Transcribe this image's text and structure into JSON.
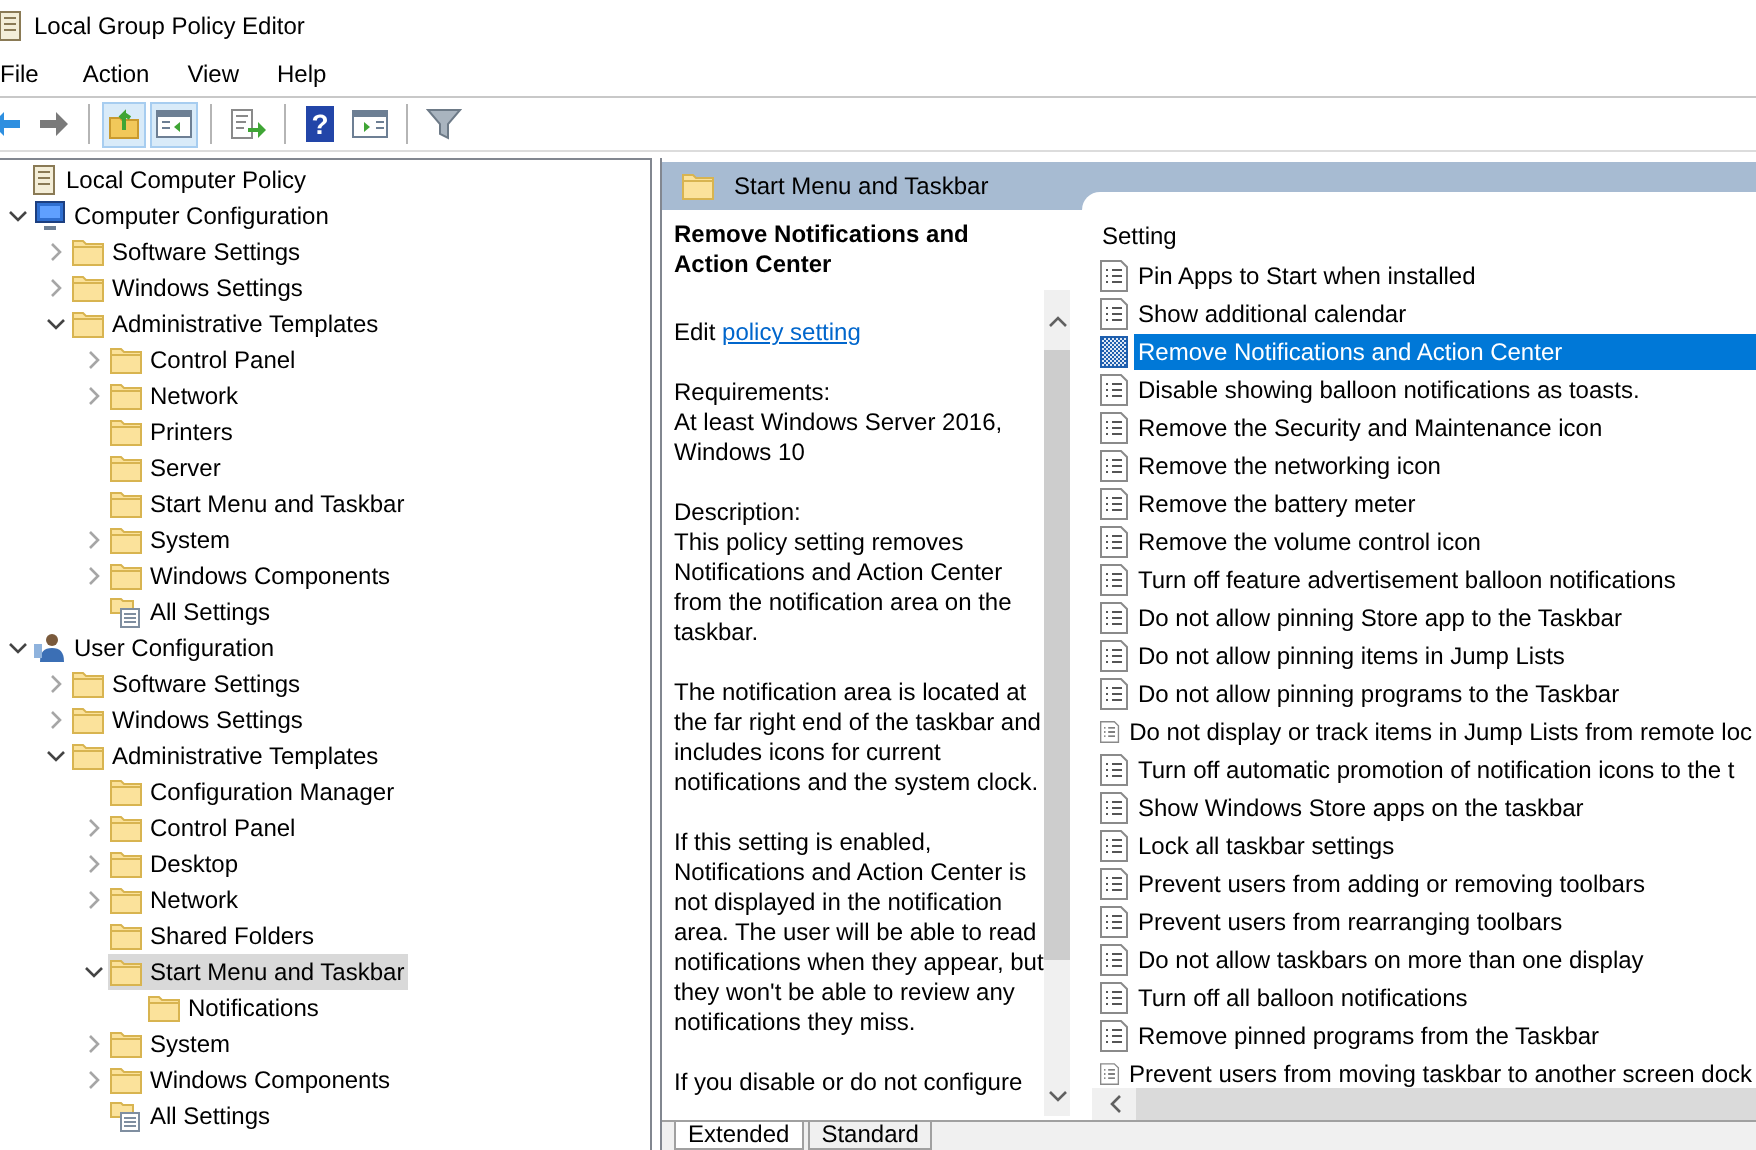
{
  "window": {
    "title": "Local Group Policy Editor"
  },
  "menu": [
    "File",
    "Action",
    "View",
    "Help"
  ],
  "toolbar": [
    {
      "kind": "back",
      "pressed": false
    },
    {
      "kind": "forward",
      "pressed": false
    },
    {
      "kind": "separator"
    },
    {
      "kind": "up",
      "pressed": true
    },
    {
      "kind": "tree",
      "pressed": true
    },
    {
      "kind": "separator"
    },
    {
      "kind": "export",
      "pressed": false
    },
    {
      "kind": "separator"
    },
    {
      "kind": "help",
      "label": "?",
      "pressed": false
    },
    {
      "kind": "action",
      "pressed": false
    },
    {
      "kind": "separator"
    },
    {
      "kind": "filter",
      "pressed": false
    }
  ],
  "tree": [
    {
      "label": "Local Computer Policy",
      "kind": "policy",
      "selected": false,
      "children": [
        {
          "label": "Computer Configuration",
          "kind": "computer",
          "expanded": true,
          "selected": false,
          "children": [
            {
              "label": "Software Settings",
              "kind": "folder",
              "expanded": false,
              "selected": false
            },
            {
              "label": "Windows Settings",
              "kind": "folder",
              "expanded": false,
              "selected": false
            },
            {
              "label": "Administrative Templates",
              "kind": "folder",
              "expanded": true,
              "selected": false,
              "children": [
                {
                  "label": "Control Panel",
                  "kind": "folder",
                  "expanded": false,
                  "selected": false
                },
                {
                  "label": "Network",
                  "kind": "folder",
                  "expanded": false,
                  "selected": false
                },
                {
                  "label": "Printers",
                  "kind": "folder",
                  "selected": false
                },
                {
                  "label": "Server",
                  "kind": "folder",
                  "selected": false
                },
                {
                  "label": "Start Menu and Taskbar",
                  "kind": "folder",
                  "selected": false
                },
                {
                  "label": "System",
                  "kind": "folder",
                  "expanded": false,
                  "selected": false
                },
                {
                  "label": "Windows Components",
                  "kind": "folder",
                  "expanded": false,
                  "selected": false
                },
                {
                  "label": "All Settings",
                  "kind": "settings",
                  "selected": false
                }
              ]
            }
          ]
        },
        {
          "label": "User Configuration",
          "kind": "user",
          "expanded": true,
          "selected": false,
          "children": [
            {
              "label": "Software Settings",
              "kind": "folder",
              "expanded": false,
              "selected": false
            },
            {
              "label": "Windows Settings",
              "kind": "folder",
              "expanded": false,
              "selected": false
            },
            {
              "label": "Administrative Templates",
              "kind": "folder",
              "expanded": true,
              "selected": false,
              "children": [
                {
                  "label": "Configuration Manager",
                  "kind": "folder",
                  "selected": false
                },
                {
                  "label": "Control Panel",
                  "kind": "folder",
                  "expanded": false,
                  "selected": false
                },
                {
                  "label": "Desktop",
                  "kind": "folder",
                  "expanded": false,
                  "selected": false
                },
                {
                  "label": "Network",
                  "kind": "folder",
                  "expanded": false,
                  "selected": false
                },
                {
                  "label": "Shared Folders",
                  "kind": "folder",
                  "selected": false
                },
                {
                  "label": "Start Menu and Taskbar",
                  "kind": "folder",
                  "expanded": true,
                  "selected": true,
                  "children": [
                    {
                      "label": "Notifications",
                      "kind": "folder",
                      "selected": false
                    }
                  ]
                },
                {
                  "label": "System",
                  "kind": "folder",
                  "expanded": false,
                  "selected": false
                },
                {
                  "label": "Windows Components",
                  "kind": "folder",
                  "expanded": false,
                  "selected": false
                },
                {
                  "label": "All Settings",
                  "kind": "settings",
                  "selected": false
                }
              ]
            }
          ]
        }
      ]
    }
  ],
  "header": {
    "title": "Start Menu and Taskbar"
  },
  "details": {
    "title": "Remove Notifications and Action Center",
    "edit_prefix": "Edit",
    "edit_link": "policy setting",
    "paragraphs": [
      "Requirements:\nAt least Windows Server 2016, Windows 10",
      "Description:\nThis policy setting removes Notifications and Action Center from the notification area on the taskbar.",
      "The notification area is located at the far right end of the taskbar and includes icons for current notifications and the system clock.",
      "If this setting is enabled, Notifications and Action Center is not displayed in the notification area. The user will be able to read notifications when they appear, but they won't be able to review any notifications they miss.",
      "If you disable or do not configure"
    ]
  },
  "settings": {
    "column": "Setting",
    "rows": [
      {
        "name": "Pin Apps to Start when installed",
        "selected": false
      },
      {
        "name": "Show additional calendar",
        "selected": false
      },
      {
        "name": "Remove Notifications and Action Center",
        "selected": true
      },
      {
        "name": "Disable showing balloon notifications as toasts.",
        "selected": false
      },
      {
        "name": "Remove the Security and Maintenance icon",
        "selected": false
      },
      {
        "name": "Remove the networking icon",
        "selected": false
      },
      {
        "name": "Remove the battery meter",
        "selected": false
      },
      {
        "name": "Remove the volume control icon",
        "selected": false
      },
      {
        "name": "Turn off feature advertisement balloon notifications",
        "selected": false
      },
      {
        "name": "Do not allow pinning Store app to the Taskbar",
        "selected": false
      },
      {
        "name": "Do not allow pinning items in Jump Lists",
        "selected": false
      },
      {
        "name": "Do not allow pinning programs to the Taskbar",
        "selected": false
      },
      {
        "name": "Do not display or track items in Jump Lists from remote loc",
        "selected": false
      },
      {
        "name": "Turn off automatic promotion of notification icons to the t",
        "selected": false
      },
      {
        "name": "Show Windows Store apps on the taskbar",
        "selected": false
      },
      {
        "name": "Lock all taskbar settings",
        "selected": false
      },
      {
        "name": "Prevent users from adding or removing toolbars",
        "selected": false
      },
      {
        "name": "Prevent users from rearranging toolbars",
        "selected": false
      },
      {
        "name": "Do not allow taskbars on more than one display",
        "selected": false
      },
      {
        "name": "Turn off all balloon notifications",
        "selected": false
      },
      {
        "name": "Remove pinned programs from the Taskbar",
        "selected": false
      },
      {
        "name": "Prevent users from moving taskbar to another screen dock",
        "selected": false
      }
    ]
  },
  "view_tabs": [
    {
      "label": "Extended",
      "selected": true
    },
    {
      "label": "Standard",
      "selected": false
    }
  ]
}
